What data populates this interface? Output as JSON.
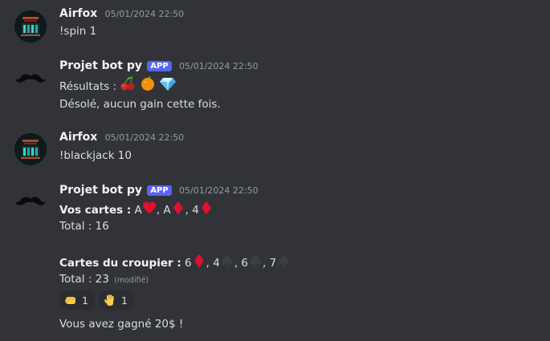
{
  "messages": [
    {
      "author": "Airfox",
      "timestamp": "05/01/2024 22:50",
      "text": "!spin 1"
    },
    {
      "author": "Projet bot py",
      "badge": "APP",
      "timestamp": "05/01/2024 22:50",
      "results_label": "Résultats :",
      "result_emojis": [
        "cherries-icon",
        "orange-icon",
        "gem-icon"
      ],
      "text2": "Désolé, aucun gain cette fois."
    },
    {
      "author": "Airfox",
      "timestamp": "05/01/2024 22:50",
      "text": "!blackjack 10"
    },
    {
      "author": "Projet bot py",
      "badge": "APP",
      "timestamp": "05/01/2024 22:50",
      "player_label": "Vos cartes :",
      "player_cards": [
        {
          "rank": "A",
          "suit": "heart"
        },
        {
          "rank": "A",
          "suit": "diamond"
        },
        {
          "rank": "4",
          "suit": "diamond"
        }
      ],
      "player_total": "Total : 16",
      "dealer_label": "Cartes du croupier :",
      "dealer_cards": [
        {
          "rank": "6",
          "suit": "diamond"
        },
        {
          "rank": "4",
          "suit": "spade"
        },
        {
          "rank": "6",
          "suit": "spade"
        },
        {
          "rank": "7",
          "suit": "spade"
        }
      ],
      "dealer_total": "Total : 23",
      "edited": "(modifié)",
      "reactions": [
        {
          "icon": "fist-icon",
          "count": "1"
        },
        {
          "icon": "raised-hand-icon",
          "count": "1"
        }
      ],
      "result_text": "Vous avez gagné 20$ !"
    }
  ],
  "colors": {
    "background": "#313338",
    "badge": "#5865f2",
    "suit_red": "#e0102e",
    "suit_spade": "#3a3d44"
  }
}
